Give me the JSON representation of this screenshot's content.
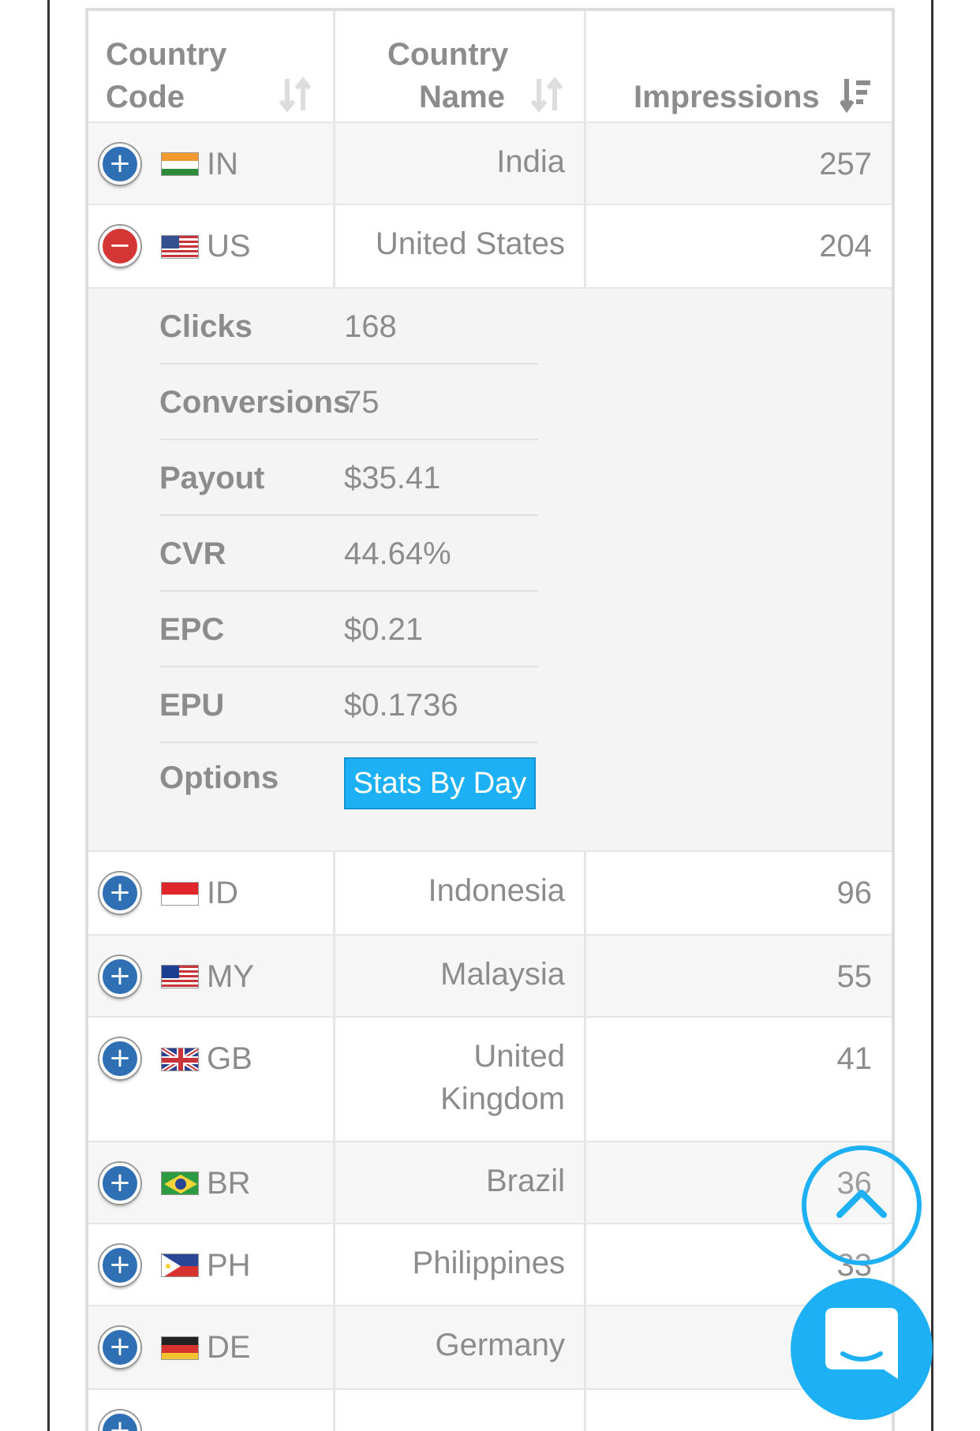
{
  "table": {
    "headers": {
      "code_line1": "Country",
      "code_line2": "Code",
      "name_line1": "Country",
      "name_line2": "Name",
      "impressions": "Impressions"
    },
    "rows": [
      {
        "code": "IN",
        "name": "India",
        "impressions": "257",
        "flag": "india-flag",
        "expanded": false
      },
      {
        "code": "US",
        "name": "United States",
        "impressions": "204",
        "flag": "us-flag",
        "expanded": true
      },
      {
        "code": "ID",
        "name": "Indonesia",
        "impressions": "96",
        "flag": "indonesia-flag",
        "expanded": false
      },
      {
        "code": "MY",
        "name": "Malaysia",
        "impressions": "55",
        "flag": "malaysia-flag",
        "expanded": false
      },
      {
        "code": "GB",
        "name_line1": "United",
        "name_line2": "Kingdom",
        "impressions": "41",
        "flag": "uk-flag",
        "expanded": false
      },
      {
        "code": "BR",
        "name": "Brazil",
        "impressions": "36",
        "flag": "brazil-flag",
        "expanded": false
      },
      {
        "code": "PH",
        "name": "Philippines",
        "impressions": "33",
        "flag": "philippines-flag",
        "expanded": false
      },
      {
        "code": "DE",
        "name": "Germany",
        "impressions": "",
        "flag": "germany-flag",
        "expanded": false
      }
    ],
    "details": {
      "clicks_label": "Clicks",
      "clicks": "168",
      "conversions_label": "Conversions",
      "conversions": "75",
      "payout_label": "Payout",
      "payout": "$35.41",
      "cvr_label": "CVR",
      "cvr": "44.64%",
      "epc_label": "EPC",
      "epc": "$0.21",
      "epu_label": "EPU",
      "epu": "$0.1736",
      "options_label": "Options",
      "stats_button": "Stats By Day"
    }
  },
  "colors": {
    "accent": "#1eb0f5",
    "expand_blue": "#2f6fb4",
    "collapse_red": "#d43535"
  }
}
